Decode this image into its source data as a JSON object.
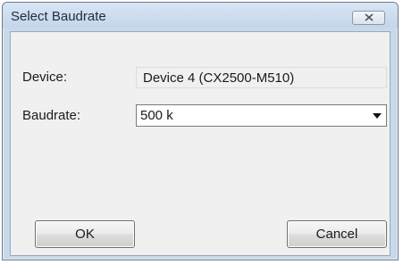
{
  "window": {
    "title": "Select Baudrate"
  },
  "form": {
    "device_label": "Device:",
    "device_value": "Device 4 (CX2500-M510)",
    "baudrate_label": "Baudrate:",
    "baudrate_selected": "500 k"
  },
  "buttons": {
    "ok_label": "OK",
    "cancel_label": "Cancel"
  },
  "icons": {
    "close": "close-icon",
    "dropdown": "chevron-down-icon"
  },
  "colors": {
    "titlebar": "#c9d9ec",
    "client_bg": "#f0f0f0"
  }
}
